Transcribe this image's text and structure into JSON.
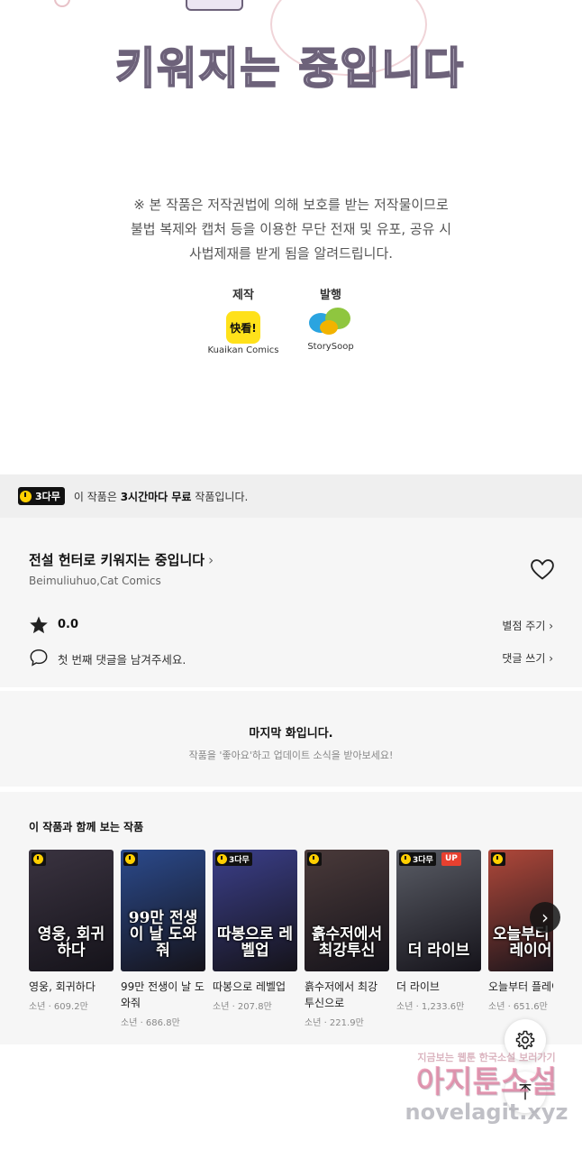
{
  "artwork": {
    "title_text": "키워지는 중입니다"
  },
  "notice": {
    "lines": [
      "※ 본 작품은 저작권법에 의해 보호를 받는 저작물이므로",
      "불법 복제와 캡처 등을 이용한 무단 전재 및 유포, 공유 시",
      "사법제재를 받게 됨을 알려드립니다."
    ]
  },
  "credits": {
    "producer_label": "제작",
    "producer_logo_text": "快看!",
    "producer_name": "Kuaikan Comics",
    "publisher_label": "발행",
    "publisher_name": "StorySoop"
  },
  "free_banner": {
    "badge": "3다무",
    "text_prefix": "이 작품은 ",
    "text_bold": "3시간마다 무료",
    "text_suffix": " 작품입니다."
  },
  "series": {
    "title": "전설 헌터로 키워지는 중입니다",
    "title_chevron": "›",
    "author": "Beimuliuhuo,Cat Comics",
    "rating": "0.0",
    "rate_link": "별점 주기 ›",
    "comment_prompt": "첫 번째 댓글을 남겨주세요.",
    "comment_link": "댓글 쓰기 ›"
  },
  "last_episode": {
    "title": "마지막 화입니다.",
    "subtitle": "작품을 '좋아요'하고 업데이트 소식을 받아보세요!"
  },
  "recommendations": {
    "heading": "이 작품과 함께 보는 작품",
    "items": [
      {
        "title": "영웅, 회귀하다",
        "meta": "소년 · 609.2만",
        "cover_text": "영웅, 회귀하다",
        "badge": "",
        "up": "",
        "bg": "#3a3340"
      },
      {
        "title": "99만 전생이 날 도와줘",
        "meta": "소년 · 686.8만",
        "cover_text": "99만 전생이 날 도와줘",
        "badge": "",
        "up": "",
        "bg": "#2b4a8c"
      },
      {
        "title": "따봉으로 레벨업",
        "meta": "소년 · 207.8만",
        "cover_text": "따봉으로 레벨업",
        "badge": "3다무",
        "up": "",
        "bg": "#3b3f8a"
      },
      {
        "title": "흙수저에서 최강 투신으로",
        "meta": "소년 · 221.9만",
        "cover_text": "흙수저에서 최강투신",
        "badge": "",
        "up": "",
        "bg": "#4a3a3a"
      },
      {
        "title": "더 라이브",
        "meta": "소년 · 1,233.6만",
        "cover_text": "더 라이브",
        "badge": "3다무",
        "up": "UP",
        "bg": "#5a5d66"
      },
      {
        "title": "오늘부터 플레이어",
        "meta": "소년 · 651.6만",
        "cover_text": "오늘부터 플레이어",
        "badge": "",
        "up": "",
        "bg": "#b0483a"
      }
    ],
    "next_label": "›"
  },
  "floating": {
    "settings_icon": "gear-icon",
    "top_icon": "arrow-up-icon"
  },
  "watermark": {
    "line1": "지금보는 웹툰 한국소설 보러가기",
    "line2": "아지툰소설",
    "line3": "novelagit.xyz"
  }
}
